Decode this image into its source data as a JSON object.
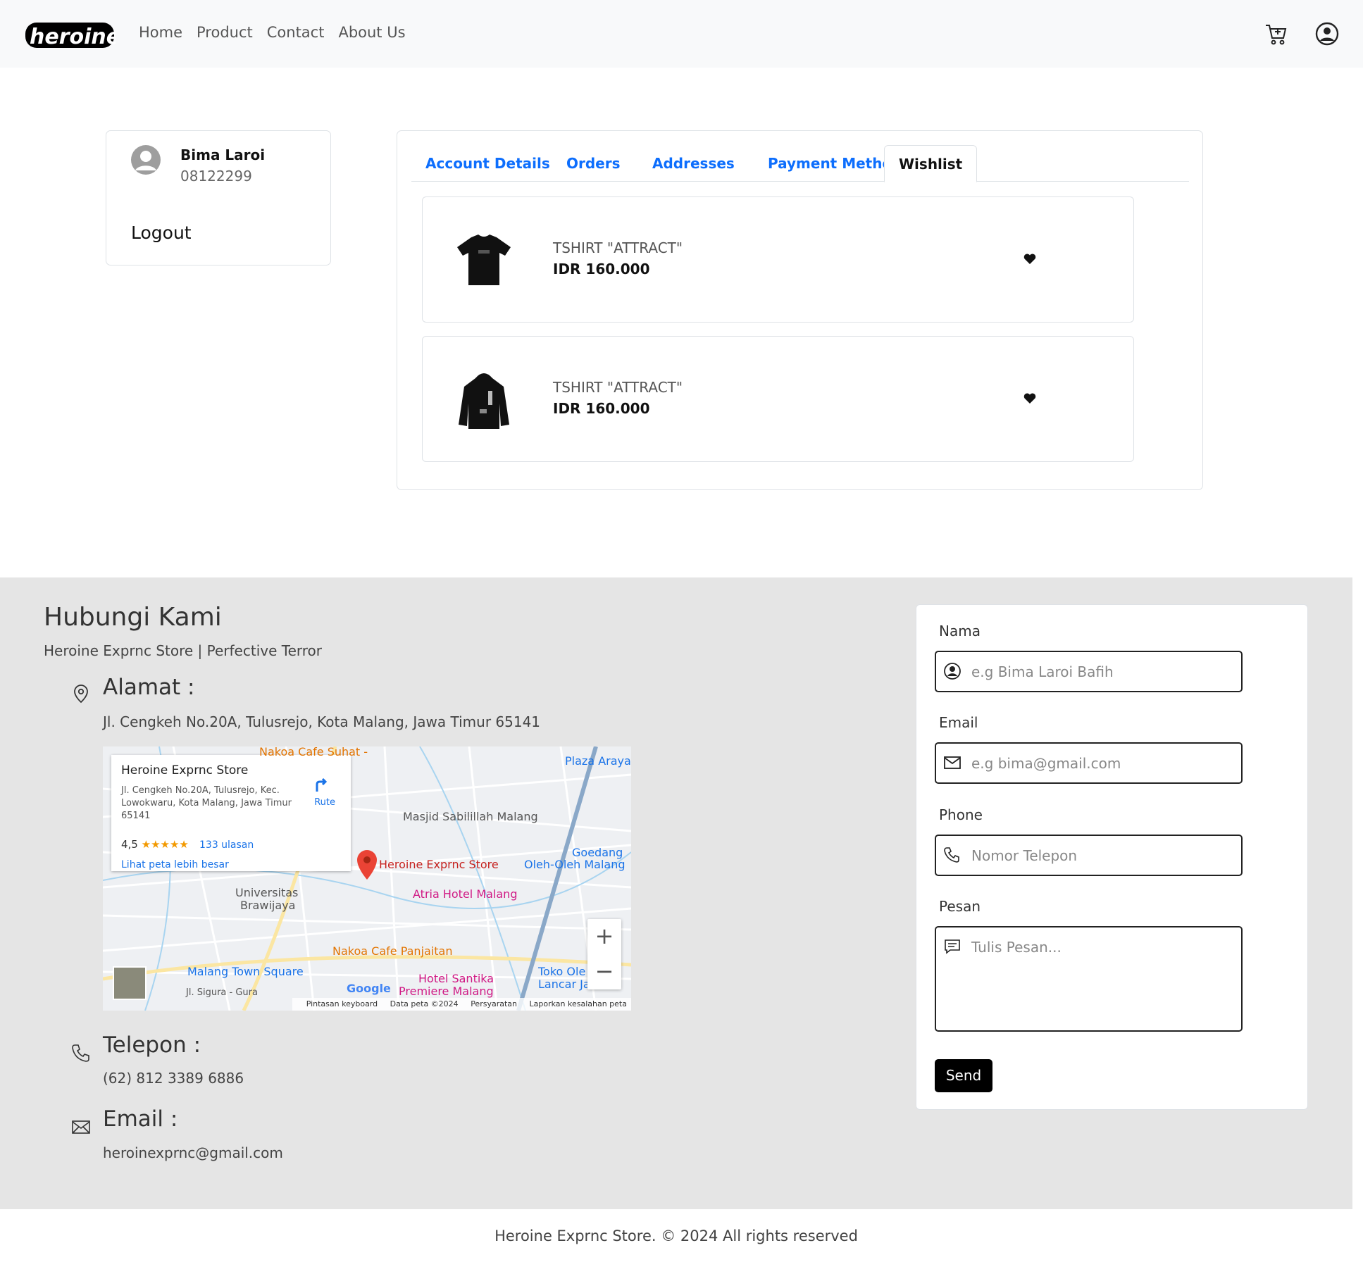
{
  "nav": {
    "links": [
      "Home",
      "Product",
      "Contact",
      "About Us"
    ],
    "cart_icon": "cart-plus-icon",
    "account_icon": "user-circle-icon"
  },
  "profile": {
    "name": "Bima Laroi",
    "phone": "08122299",
    "logout": "Logout"
  },
  "tabs": [
    "Account Details",
    "Orders",
    "Addresses",
    "Payment Method",
    "Wishlist"
  ],
  "active_tab": "Wishlist",
  "wishlist": [
    {
      "name": "TSHIRT \"ATTRACT\"",
      "price": "IDR 160.000",
      "image": "black-tshirt"
    },
    {
      "name": "TSHIRT \"ATTRACT\"",
      "price": "IDR 160.000",
      "image": "black-hoodie"
    }
  ],
  "contact": {
    "title": "Hubungi Kami",
    "subtitle": "Heroine Exprnc Store | Perfective Terror",
    "address_head": "Alamat :",
    "address": "Jl. Cengkeh No.20A, Tulusrejo, Kota Malang, Jawa Timur 65141",
    "phone_head": "Telepon :",
    "phone": "(62) 812 3389 6886",
    "email_head": "Email :",
    "email": "heroinexprnc@gmail.com"
  },
  "map": {
    "card_title": "Heroine Exprnc Store",
    "card_address": "Jl. Cengkeh No.20A, Tulusrejo, Kec. Lowokwaru, Kota Malang, Jawa Timur 65141",
    "route": "Rute",
    "rating": "4,5",
    "stars": "★★★★★",
    "reviews": "133 ulasan",
    "bigger_map": "Lihat peta lebih besar",
    "labels": {
      "store": "Heroine Exprnc Store",
      "nakoa_suhat": "Nakoa Cafe Suhat -",
      "plaza": "Plaza Araya",
      "masjid": "Masjid Sabilillah Malang",
      "goedang": "Goedang",
      "oleh": "Oleh-Oleh Malang",
      "atria": "Atria Hotel Malang",
      "univ": "Universitas",
      "brawijaya": "Brawijaya",
      "nakoa_panjaitan": "Nakoa Cafe Panjaitan",
      "mts": "Malang Town Square",
      "santika1": "Hotel Santika",
      "santika2": "Premiere Malang",
      "toko1": "Toko Ole",
      "toko2": "Lancar Ja",
      "google": "Google",
      "sigura": "Jl. Sigura - Gura"
    },
    "footer": [
      "Pintasan keyboard",
      "Data peta ©2024",
      "Persyaratan",
      "Laporkan kesalahan peta"
    ]
  },
  "form": {
    "name_label": "Nama",
    "name_placeholder": "e.g Bima Laroi Bafih",
    "email_label": "Email",
    "email_placeholder": "e.g bima@gmail.com",
    "phone_label": "Phone",
    "phone_placeholder": "Nomor Telepon",
    "message_label": "Pesan",
    "message_placeholder": "Tulis Pesan...",
    "send": "Send"
  },
  "copyright": "Heroine Exprnc Store. © 2024 All rights reserved"
}
